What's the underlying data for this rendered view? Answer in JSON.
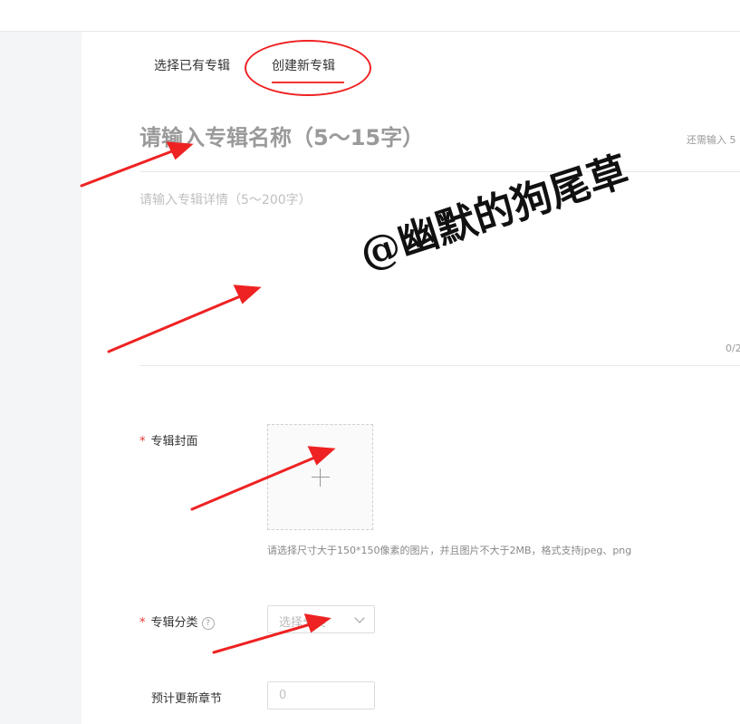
{
  "tabs": {
    "existing": "选择已有专辑",
    "new": "创建新专辑"
  },
  "form": {
    "title_placeholder": "请输入专辑名称（5～15字）",
    "remaining_label": "还需输入 5",
    "desc_placeholder": "请输入专辑详情（5～200字）",
    "desc_counter": "0/2",
    "cover_label": "专辑封面",
    "required_mark": "*",
    "cover_hint": "请选择尺寸大于150*150像素的图片，并且图片不大于2MB，格式支持jpeg、png",
    "category_label": "专辑分类",
    "category_help": "?",
    "category_placeholder": "选择分类",
    "chapters_label": "预计更新章节",
    "chapters_placeholder": "0"
  },
  "watermark": "@幽默的狗尾草",
  "colors": {
    "accent": "#e33333",
    "annotation": "#ee2222"
  },
  "icons": {
    "upload": "plus-icon",
    "select": "chevron-down-icon",
    "help": "question-circle-icon"
  }
}
